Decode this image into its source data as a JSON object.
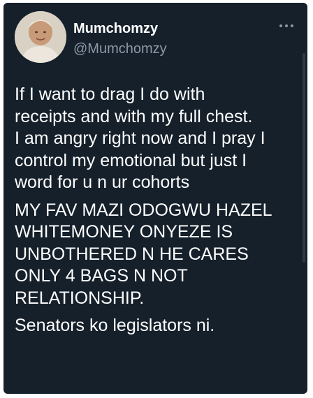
{
  "tweet": {
    "display_name": "Mumchomzy",
    "handle": "@Mumchomzy",
    "more_icon": "ellipsis-icon",
    "paragraphs": [
      "If I want to drag I do with\nreceipts and with my full chest.\nI am angry right now and I pray I\ncontrol my emotional but just I\nword for u n ur cohorts",
      "MY FAV MAZI ODOGWU HAZEL\nWHITEMONEY ONYEZE IS\nUNBOTHERED N HE CARES\nONLY 4 BAGS N NOT\nRELATIONSHIP.",
      "Senators ko legislators ni."
    ]
  },
  "colors": {
    "background": "#15202b",
    "primary_text": "#ffffff",
    "secondary_text": "#8b98a5"
  }
}
